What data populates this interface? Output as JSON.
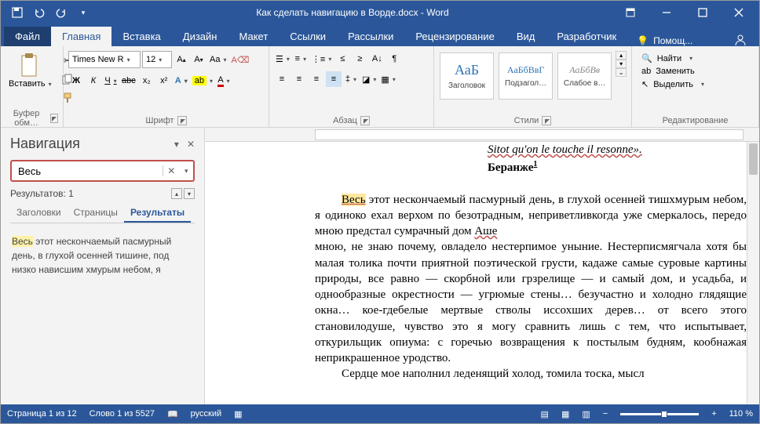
{
  "titlebar": {
    "title": "Как сделать навигацию в Ворде.docx - Word"
  },
  "tabs": {
    "file": "Файл",
    "home": "Главная",
    "insert": "Вставка",
    "design": "Дизайн",
    "layout": "Макет",
    "references": "Ссылки",
    "mailings": "Рассылки",
    "review": "Рецензирование",
    "view": "Вид",
    "developer": "Разработчик",
    "help": "Помощ..."
  },
  "ribbon": {
    "clipboard": {
      "label": "Буфер обм…",
      "paste": "Вставить"
    },
    "font": {
      "label": "Шрифт",
      "name": "Times New R",
      "size": "12",
      "bold": "Ж",
      "italic": "К",
      "underline": "Ч",
      "strike": "abc",
      "sub": "x₂",
      "sup": "x²",
      "caseAa": "Aa",
      "clear": "A"
    },
    "paragraph": {
      "label": "Абзац"
    },
    "styles": {
      "label": "Стили",
      "preview": "АаБ",
      "preview2": "АаБбВвГ",
      "preview3": "АаБбВв",
      "s1": "Заголовок",
      "s2": "Подзагол…",
      "s3": "Слабое в…"
    },
    "editing": {
      "label": "Редактирование",
      "find": "Найти",
      "replace": "Заменить",
      "select": "Выделить"
    }
  },
  "nav": {
    "title": "Навигация",
    "search_value": "Весь",
    "results_label": "Результатов: 1",
    "tabs": {
      "headings": "Заголовки",
      "pages": "Страницы",
      "results": "Результаты"
    },
    "result": {
      "hl": "Весь",
      "rest": " этот нескончаемый пасмурный день, в глухой осенней тишине, под низко нависшим хмурым небом, я"
    }
  },
  "doc": {
    "epigraph": "Sitot qu'on le touche il resonne».",
    "author": "Беранже",
    "sup": "1",
    "body_hl": "Весь",
    "body": " этот нескончаемый пасмурный день, в глухой осенней тишхмурым небом, я одиноко ехал верхом по безотрадным, неприветливкогда уже смеркалось, передо мною предстал сумрачный дом ",
    "ashe": "Аше",
    "body2": "мною, не знаю почему, овладело нестерпимое уныние. Нестерписмягчала хотя бы малая толика почти приятной поэтической грусти, кадаже самые суровые картины природы, все равно — скорбной или грзрелище — и самый дом, и усадьба, и однообразные окрестности — угрюмые стены… безучастно и холодно глядящие окна… кое-гдебелые мертвые стволы иссохших дерев… от всего этого становилодуше, чувство это я могу сравнить лишь с тем, что испытывает, откурильщик опиума: с горечью возвращения к постылым будням, кообнажая неприкрашенное уродство.",
    "body3": "Сердце мое наполнил леденящий холод, томила тоска, мысл"
  },
  "status": {
    "page": "Страница 1 из 12",
    "words": "Слово 1 из 5527",
    "lang": "русский",
    "zoom": "110 %"
  }
}
